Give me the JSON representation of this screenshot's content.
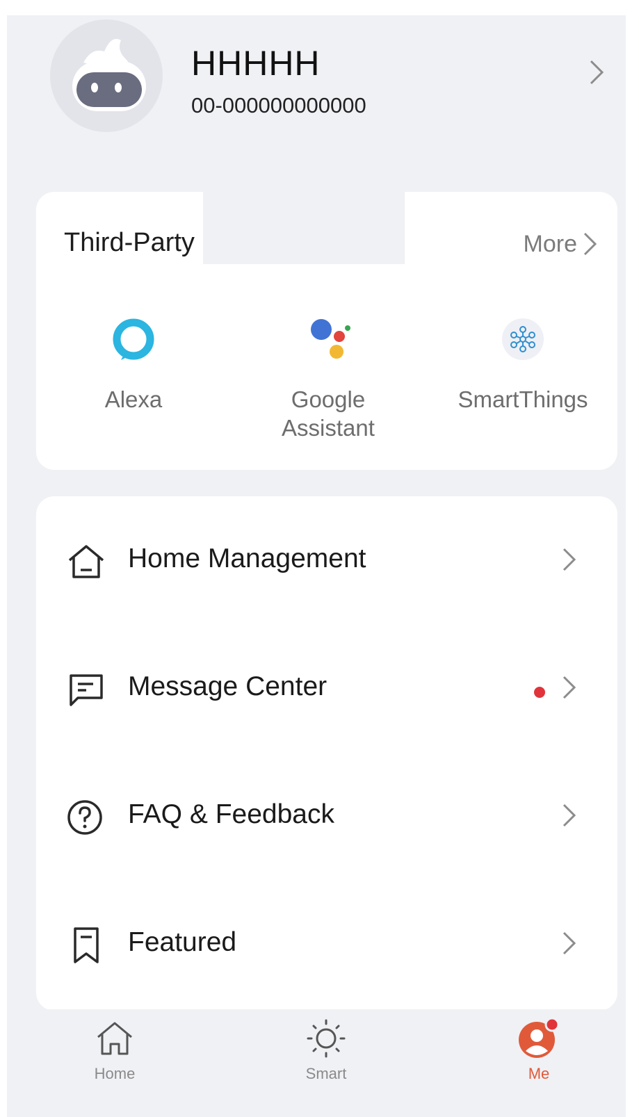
{
  "profile": {
    "name": "HHHHH",
    "account_id": "00-000000000000"
  },
  "third_party": {
    "title": "Third-Party",
    "more_label": "More",
    "services": [
      {
        "label": "Alexa",
        "icon": "alexa-icon"
      },
      {
        "label_line1": "Google",
        "label_line2": "Assistant",
        "icon": "google-assistant-icon"
      },
      {
        "label": "SmartThings",
        "icon": "smartthings-icon"
      }
    ]
  },
  "menu": {
    "items": [
      {
        "label": "Home Management",
        "icon": "house-icon",
        "badge": false
      },
      {
        "label": "Message Center",
        "icon": "message-icon",
        "badge": true
      },
      {
        "label": "FAQ & Feedback",
        "icon": "question-circle-icon",
        "badge": false
      },
      {
        "label": "Featured",
        "icon": "bookmark-icon",
        "badge": false
      }
    ]
  },
  "bottom_nav": {
    "items": [
      {
        "label": "Home",
        "icon": "home-icon",
        "active": false
      },
      {
        "label": "Smart",
        "icon": "sun-icon",
        "active": false
      },
      {
        "label": "Me",
        "icon": "user-icon",
        "active": true
      }
    ]
  },
  "colors": {
    "background": "#f0f1f5",
    "card": "#ffffff",
    "accent": "#e05a3a",
    "badge": "#e0343a",
    "alexa": "#2bb5e0"
  }
}
